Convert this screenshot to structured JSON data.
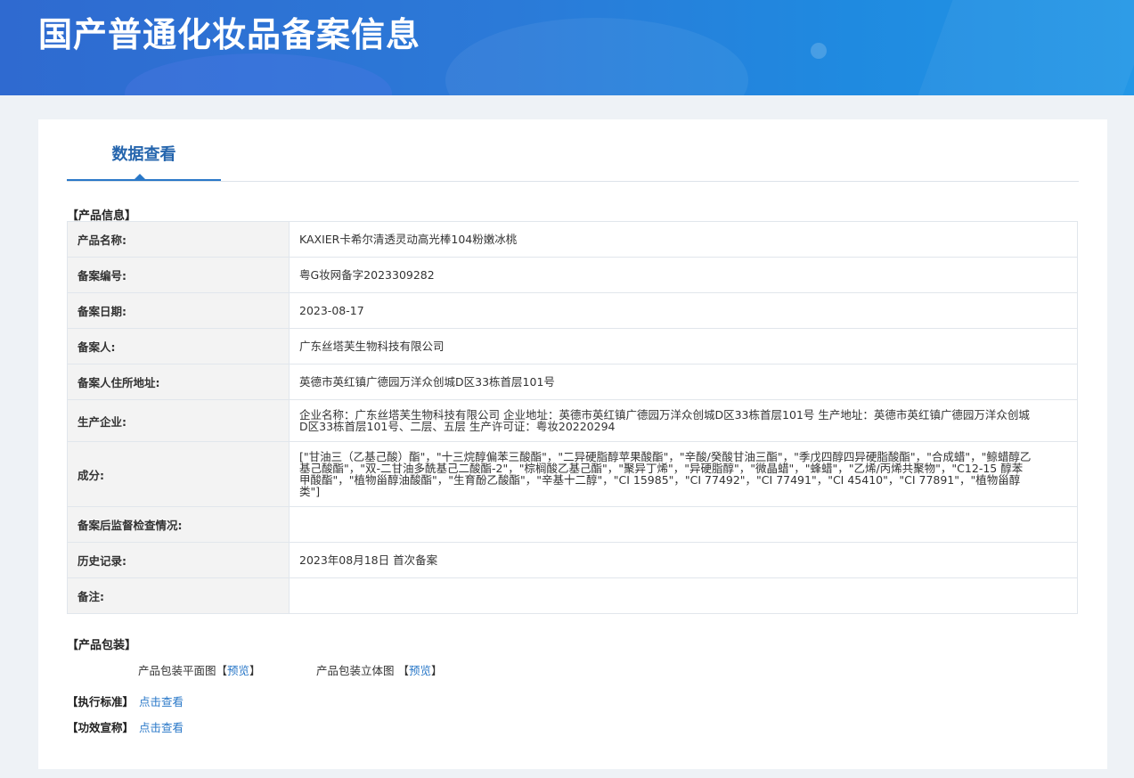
{
  "banner": {
    "title": "国产普通化妆品备案信息"
  },
  "tabs": [
    {
      "label": "数据查看",
      "active": true
    }
  ],
  "product_info": {
    "section_label": "【产品信息】",
    "rows": [
      {
        "key": "产品名称:",
        "value": "KAXIER卡希尔清透灵动高光棒104粉嫩冰桃"
      },
      {
        "key": "备案编号:",
        "value": "粤G妆网备字2023309282"
      },
      {
        "key": "备案日期:",
        "value": "2023-08-17"
      },
      {
        "key": "备案人:",
        "value": "广东丝塔芙生物科技有限公司"
      },
      {
        "key": "备案人住所地址:",
        "value": "英德市英红镇广德园万洋众创城D区33栋首层101号"
      },
      {
        "key": "生产企业:",
        "value": "企业名称：广东丝塔芙生物科技有限公司 企业地址：英德市英红镇广德园万洋众创城D区33栋首层101号 生产地址：英德市英红镇广德园万洋众创城D区33栋首层101号、二层、五层 生产许可证：粤妆20220294"
      },
      {
        "key": "成分:",
        "value": "[\"甘油三（乙基己酸）酯\"，\"十三烷醇偏苯三酸酯\"，\"二异硬脂醇苹果酸酯\"，\"辛酸/癸酸甘油三酯\"，\"季戊四醇四异硬脂酸酯\"，\"合成蜡\"，\"鲸蜡醇乙基己酸酯\"，\"双-二甘油多酰基己二酸酯-2\"，\"棕榈酸乙基己酯\"，\"聚异丁烯\"，\"异硬脂醇\"，\"微晶蜡\"，\"蜂蜡\"，\"乙烯/丙烯共聚物\"，\"C12-15 醇苯甲酸酯\"，\"植物甾醇油酸酯\"，\"生育酚乙酸酯\"，\"辛基十二醇\"，\"CI 15985\"，\"CI 77492\"，\"CI 77491\"，\"CI 45410\"，\"CI 77891\"，\"植物甾醇类\"]"
      },
      {
        "key": "备案后监督检查情况:",
        "value": ""
      },
      {
        "key": "历史记录:",
        "value": "2023年08月18日 首次备案"
      },
      {
        "key": "备注:",
        "value": ""
      }
    ]
  },
  "packaging": {
    "section_label": "【产品包装】",
    "flat_label": "产品包装平面图【",
    "flat_link": "预览",
    "flat_close": "】",
    "stereo_label": "产品包装立体图 【",
    "stereo_link": "预览",
    "stereo_close": "】"
  },
  "standard": {
    "label": "【执行标准】",
    "link": "点击查看"
  },
  "efficacy": {
    "label": "【功效宣称】",
    "link": "点击查看"
  },
  "colors": {
    "banner": "#2b7ad8",
    "tab_active": "#2565ad",
    "link": "#2a78c8",
    "key_bg": "#f3f3f3",
    "page_bg": "#eef2f6"
  }
}
